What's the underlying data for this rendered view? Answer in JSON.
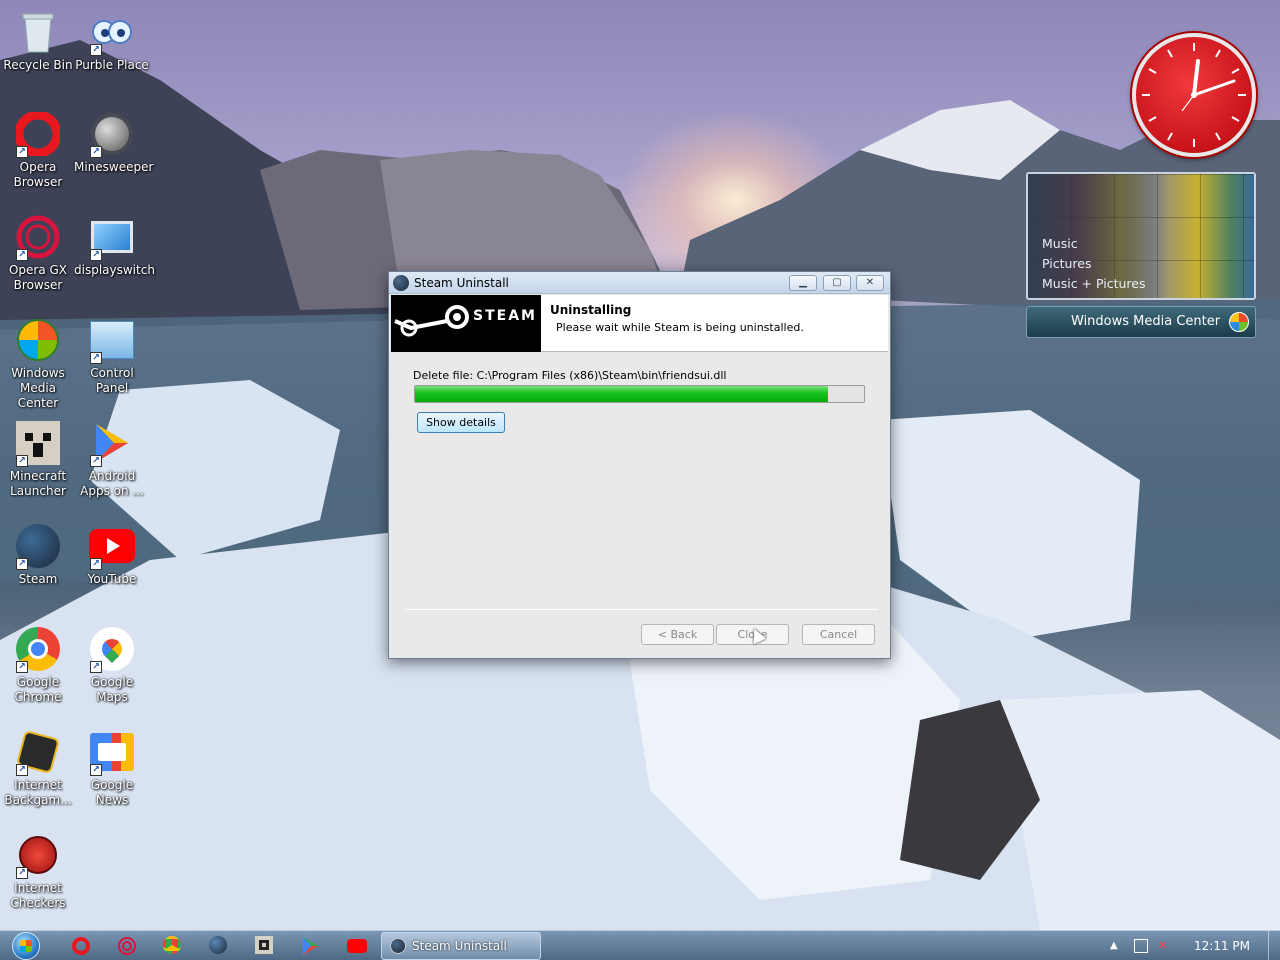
{
  "desktop": {
    "icons": [
      {
        "label": "Recycle Bin"
      },
      {
        "label": "Purble Place"
      },
      {
        "label": "Opera Browser"
      },
      {
        "label": "Minesweeper"
      },
      {
        "label": "Opera GX Browser"
      },
      {
        "label": "displayswitch"
      },
      {
        "label": "Windows Media Center"
      },
      {
        "label": "Control Panel"
      },
      {
        "label": "Minecraft Launcher"
      },
      {
        "label": "Android Apps on ..."
      },
      {
        "label": "Steam"
      },
      {
        "label": "YouTube"
      },
      {
        "label": "Google Chrome"
      },
      {
        "label": "Google Maps"
      },
      {
        "label": "Internet Backgam..."
      },
      {
        "label": "Google News"
      },
      {
        "label": "Internet Checkers"
      }
    ]
  },
  "gadgets": {
    "media_center": {
      "menu": [
        "Music",
        "Pictures",
        "Music + Pictures"
      ],
      "title": "Windows Media Center"
    }
  },
  "dialog": {
    "title": "Steam Uninstall",
    "header_title": "Uninstalling",
    "header_subtitle": "Please wait while Steam is being uninstalled.",
    "steam_word": "STEAM",
    "status": "Delete file: C:\\Program Files (x86)\\Steam\\bin\\friendsui.dll",
    "progress_percent": 92,
    "show_details_label": "Show details",
    "back_label": "< Back",
    "close_label": "Close",
    "cancel_label": "Cancel"
  },
  "taskbar": {
    "active_task": "Steam Uninstall",
    "clock": "12:11 PM"
  },
  "colors": {
    "progress_fill": "#14c21a",
    "clock_face": "#c8141a"
  }
}
